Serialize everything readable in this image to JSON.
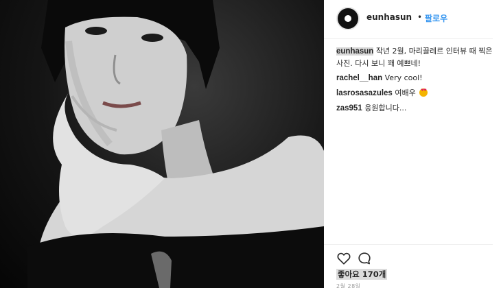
{
  "header": {
    "username": "eunhasun",
    "separator": "•",
    "follow_label": "팔로우"
  },
  "comments": [
    {
      "user": "eunhasun",
      "text": "작년 2월, 마리끌레르 인터뷰 때 찍은 사진. 다시 보니 꽤 예쁘네!"
    },
    {
      "user": "rachel__han",
      "text": "Very cool!"
    },
    {
      "user": "lasrosasazules",
      "text": "여배우"
    },
    {
      "user": "zas951",
      "text": "응원합니다..."
    }
  ],
  "icons": {
    "like": "heart-outline-icon",
    "comment": "speech-bubble-icon",
    "emoji": "heart-eyes-emoji"
  },
  "likes_label": "좋아요 170개",
  "date_label": "2월 28일",
  "colors": {
    "link_blue": "#3897f0",
    "text": "#262626",
    "muted": "#999999"
  }
}
